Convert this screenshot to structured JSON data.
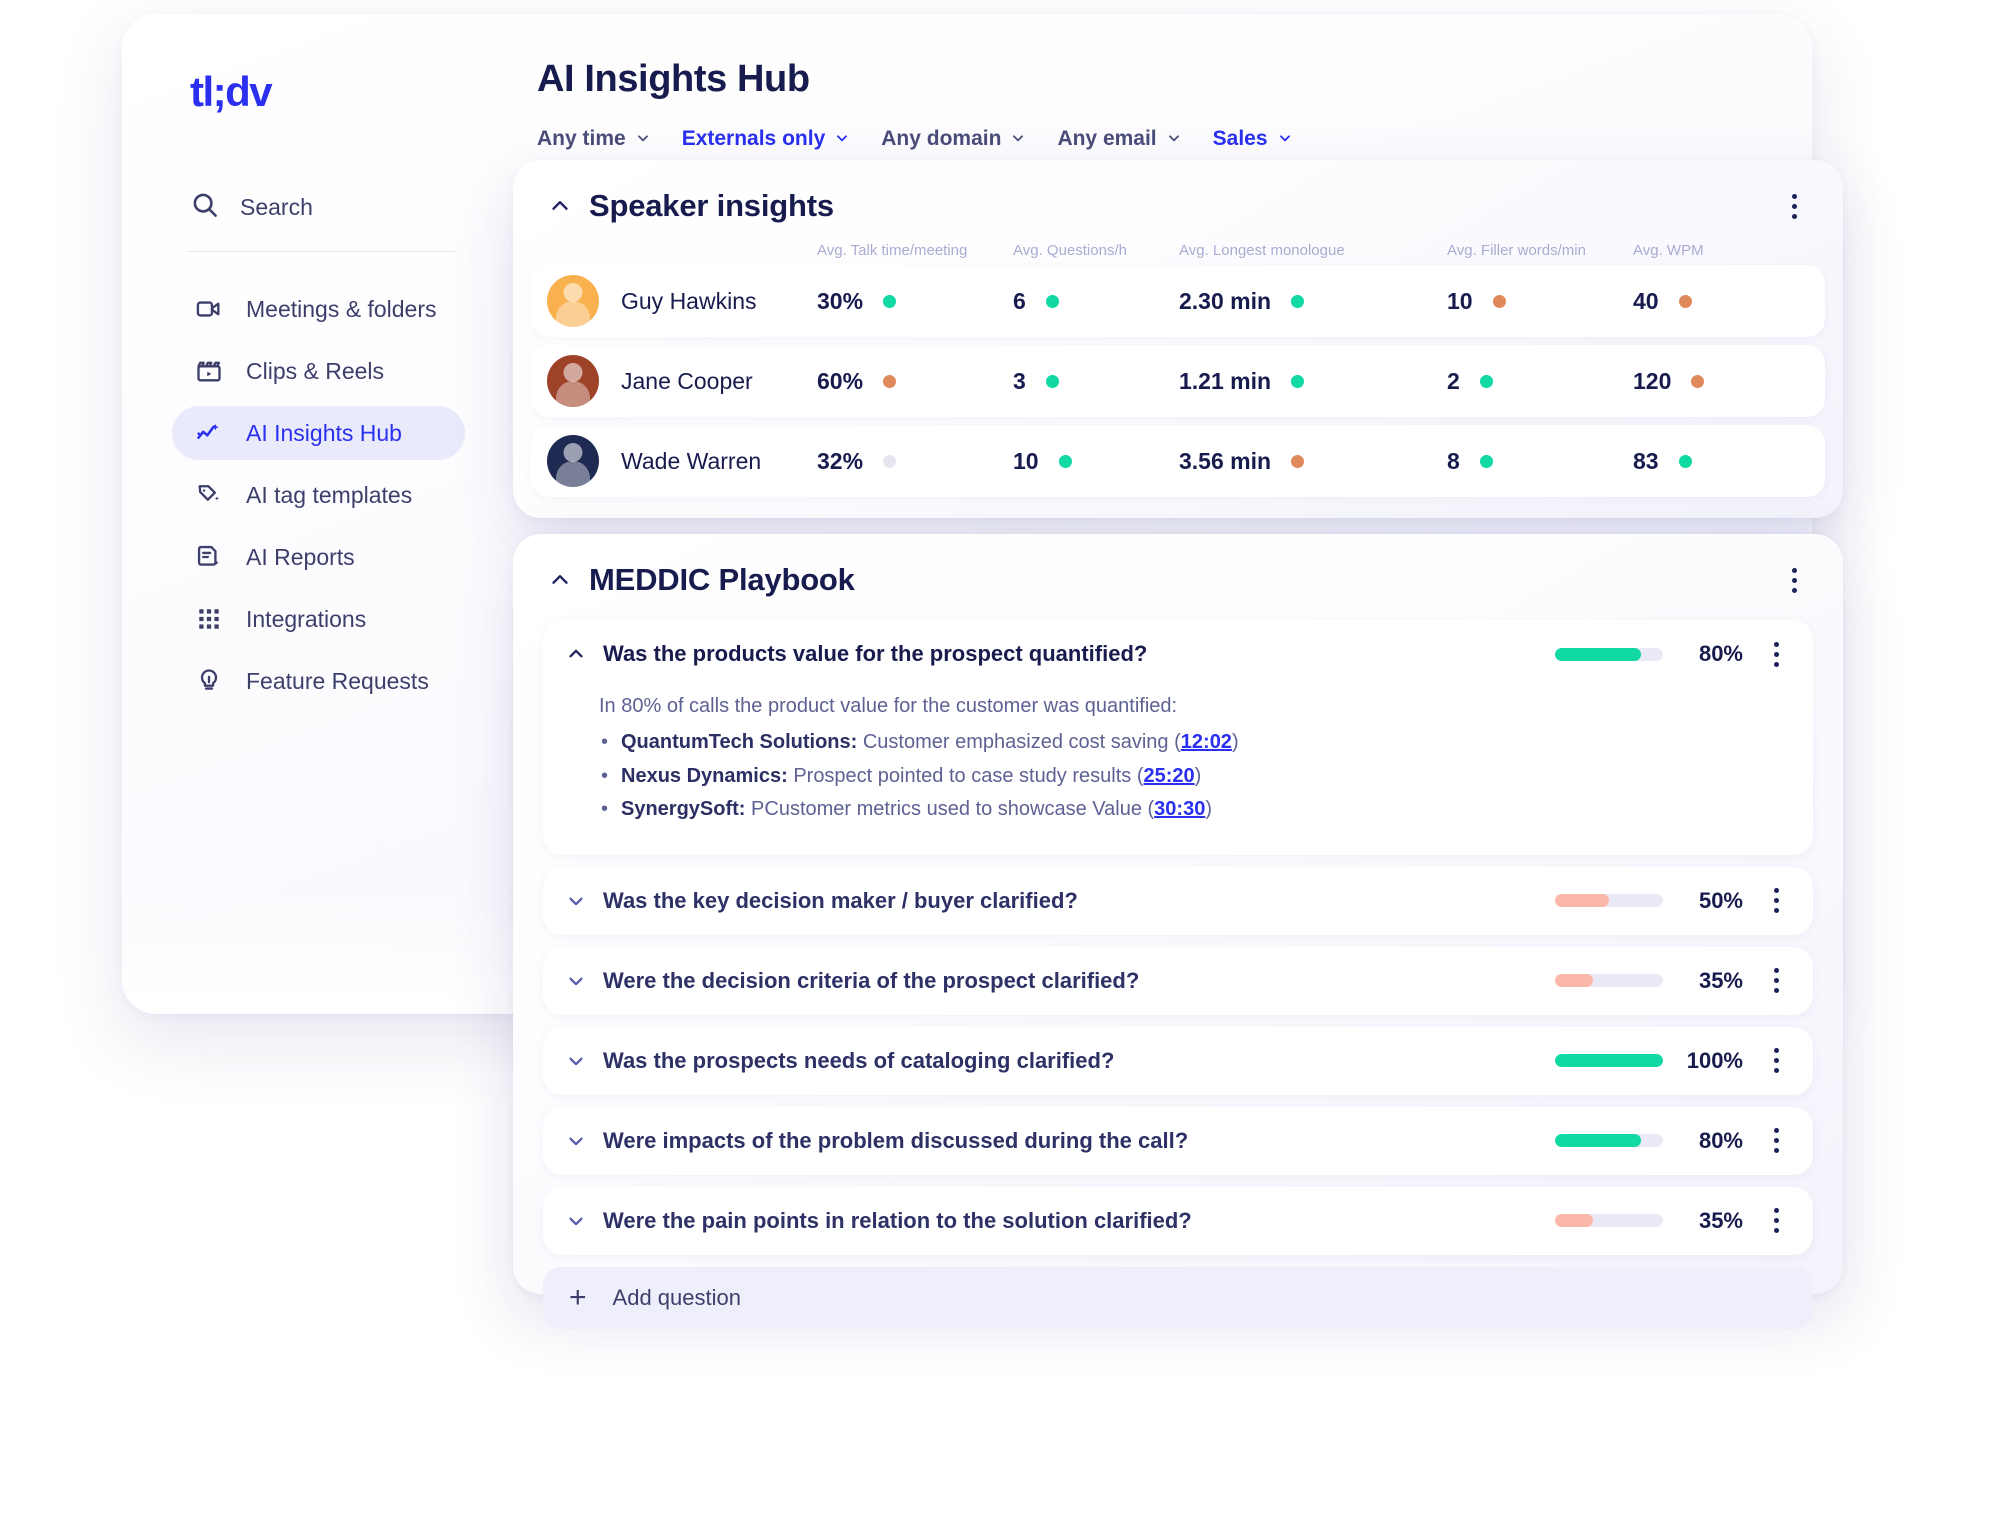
{
  "brand": {
    "logo_text": "tl;dv",
    "accent": "#2b30f0",
    "good": "#10d9a3",
    "warn": "#fbb8a8"
  },
  "sidebar": {
    "search_label": "Search",
    "items": [
      {
        "label": "Meetings & folders",
        "icon": "video-camera-icon",
        "active": false
      },
      {
        "label": "Clips & Reels",
        "icon": "clapperboard-icon",
        "active": false
      },
      {
        "label": "AI Insights Hub",
        "icon": "sparkle-chart-icon",
        "active": true
      },
      {
        "label": "AI tag templates",
        "icon": "tag-sparkle-icon",
        "active": false
      },
      {
        "label": "AI Reports",
        "icon": "report-sparkle-icon",
        "active": false
      },
      {
        "label": "Integrations",
        "icon": "grid-dots-icon",
        "active": false
      },
      {
        "label": "Feature Requests",
        "icon": "lightbulb-icon",
        "active": false
      }
    ]
  },
  "header": {
    "title": "AI Insights Hub",
    "filters": [
      {
        "label": "Any time",
        "active": false
      },
      {
        "label": "Externals only",
        "active": true
      },
      {
        "label": "Any domain",
        "active": false
      },
      {
        "label": "Any email",
        "active": false
      },
      {
        "label": "Sales",
        "active": true
      }
    ]
  },
  "speaker_insights": {
    "title": "Speaker insights",
    "columns": [
      "",
      "Avg. Talk time/meeting",
      "Avg. Questions/h",
      "Avg. Longest monologue",
      "Avg. Filler words/min",
      "Avg. WPM"
    ],
    "rows": [
      {
        "name": "Guy Hawkins",
        "avatar": "av1",
        "talk_time": "30%",
        "talk_status": "good",
        "questions": "6",
        "questions_status": "good",
        "monologue": "2.30 min",
        "monologue_status": "good",
        "filler": "10",
        "filler_status": "warn",
        "wpm": "40",
        "wpm_status": "warn"
      },
      {
        "name": "Jane Cooper",
        "avatar": "av2",
        "talk_time": "60%",
        "talk_status": "warn",
        "questions": "3",
        "questions_status": "good",
        "monologue": "1.21 min",
        "monologue_status": "good",
        "filler": "2",
        "filler_status": "good",
        "wpm": "120",
        "wpm_status": "warn"
      },
      {
        "name": "Wade Warren",
        "avatar": "av3",
        "talk_time": "32%",
        "talk_status": "none",
        "questions": "10",
        "questions_status": "good",
        "monologue": "3.56 min",
        "monologue_status": "warn",
        "filler": "8",
        "filler_status": "good",
        "wpm": "83",
        "wpm_status": "good"
      }
    ]
  },
  "meddic": {
    "title": "MEDDIC Playbook",
    "add_question_label": "Add question",
    "questions": [
      {
        "text": "Was the products value for the prospect quantified?",
        "percent": "80%",
        "percent_value": 80,
        "bar_color": "good",
        "expanded": true,
        "intro": "In 80% of calls the product value for the customer was quantified:",
        "bullets": [
          {
            "company": "QuantumTech Solutions:",
            "detail": "Customer emphasized cost saving",
            "timestamp": "12:02"
          },
          {
            "company": "Nexus Dynamics:",
            "detail": "Prospect pointed to case study results",
            "timestamp": "25:20"
          },
          {
            "company": "SynergySoft:",
            "detail": "PCustomer metrics used to showcase Value",
            "timestamp": "30:30"
          }
        ]
      },
      {
        "text": "Was the key decision maker / buyer clarified?",
        "percent": "50%",
        "percent_value": 50,
        "bar_color": "warn",
        "expanded": false
      },
      {
        "text": "Were the decision criteria of the prospect clarified?",
        "percent": "35%",
        "percent_value": 35,
        "bar_color": "warn",
        "expanded": false
      },
      {
        "text": "Was the prospects needs of cataloging clarified?",
        "percent": "100%",
        "percent_value": 100,
        "bar_color": "good",
        "expanded": false
      },
      {
        "text": "Were impacts of the problem discussed during the call?",
        "percent": "80%",
        "percent_value": 80,
        "bar_color": "good",
        "expanded": false
      },
      {
        "text": "Were the pain points in relation to the solution clarified?",
        "percent": "35%",
        "percent_value": 35,
        "bar_color": "warn",
        "expanded": false
      }
    ]
  }
}
